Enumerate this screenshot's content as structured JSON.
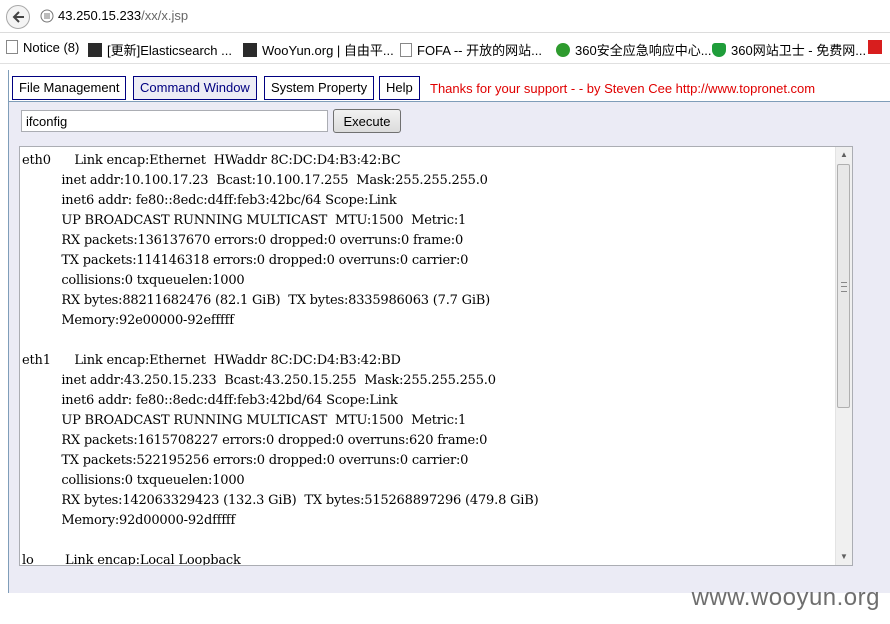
{
  "browser": {
    "url_host": "43.250.15.233",
    "url_path": "/xx/x.jsp",
    "bookmarks": [
      {
        "label": "Notice (8)",
        "icon": "page-icon"
      },
      {
        "label": "[更新]Elasticsearch ...",
        "icon": "app-icon"
      },
      {
        "label": "WooYun.org | 自由平...",
        "icon": "wooyun-icon"
      },
      {
        "label": "FOFA -- 开放的网站...",
        "icon": "page-icon"
      },
      {
        "label": "360安全应急响应中心...",
        "icon": "plus-icon"
      },
      {
        "label": "360网站卫士 - 免费网...",
        "icon": "shield-icon"
      }
    ]
  },
  "app": {
    "tabs": [
      {
        "label": "File Management",
        "active": false
      },
      {
        "label": "Command Window",
        "active": true
      },
      {
        "label": "System Property",
        "active": false
      },
      {
        "label": "Help",
        "active": false
      }
    ],
    "thanks": "Thanks for your support - - by Steven Cee http://www.topronet.com",
    "command": {
      "value": "ifconfig",
      "execute_label": "Execute"
    },
    "output": "eth0      Link encap:Ethernet  HWaddr 8C:DC:D4:B3:42:BC\n          inet addr:10.100.17.23  Bcast:10.100.17.255  Mask:255.255.255.0\n          inet6 addr: fe80::8edc:d4ff:feb3:42bc/64 Scope:Link\n          UP BROADCAST RUNNING MULTICAST  MTU:1500  Metric:1\n          RX packets:136137670 errors:0 dropped:0 overruns:0 frame:0\n          TX packets:114146318 errors:0 dropped:0 overruns:0 carrier:0\n          collisions:0 txqueuelen:1000\n          RX bytes:88211682476 (82.1 GiB)  TX bytes:8335986063 (7.7 GiB)\n          Memory:92e00000-92efffff\n\neth1      Link encap:Ethernet  HWaddr 8C:DC:D4:B3:42:BD\n          inet addr:43.250.15.233  Bcast:43.250.15.255  Mask:255.255.255.0\n          inet6 addr: fe80::8edc:d4ff:feb3:42bd/64 Scope:Link\n          UP BROADCAST RUNNING MULTICAST  MTU:1500  Metric:1\n          RX packets:1615708227 errors:0 dropped:0 overruns:620 frame:0\n          TX packets:522195256 errors:0 dropped:0 overruns:0 carrier:0\n          collisions:0 txqueuelen:1000\n          RX bytes:142063329423 (132.3 GiB)  TX bytes:515268897296 (479.8 GiB)\n          Memory:92d00000-92dfffff\n\nlo        Link encap:Local Loopback"
  },
  "watermark": "www.wooyun.org",
  "colors": {
    "tab_border": "#000080",
    "thanks_text": "#e00000",
    "panel_bg": "#ebebf5"
  }
}
